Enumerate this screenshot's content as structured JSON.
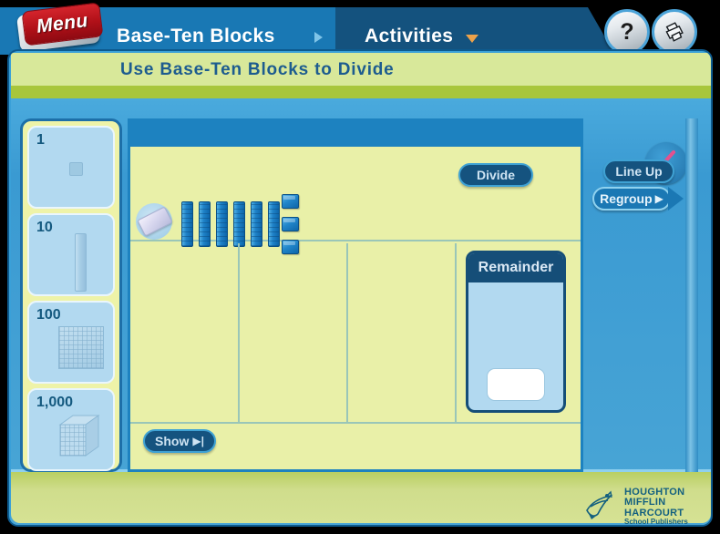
{
  "nav": {
    "menu_label": "Menu",
    "title": "Base-Ten Blocks",
    "arrow_icon": "triangle-right-icon",
    "section": "Activities",
    "caret_icon": "chevron-down-icon",
    "help_label": "?",
    "help_icon": "question-mark-icon",
    "print_icon": "printer-icon"
  },
  "header": {
    "subtitle": "Use Base-Ten Blocks to Divide"
  },
  "tools": {
    "broom_icon": "broom-icon",
    "eraser_icon": "eraser-icon"
  },
  "palette": {
    "items": [
      {
        "label": "1",
        "block": "unit-cube"
      },
      {
        "label": "10",
        "block": "rod"
      },
      {
        "label": "100",
        "block": "flat"
      },
      {
        "label": "1,000",
        "block": "large-cube"
      }
    ]
  },
  "workspace": {
    "rod_count": 6,
    "unit_count": 3,
    "column_count": 3,
    "remainder": {
      "title": "Remainder",
      "value": ""
    }
  },
  "buttons": {
    "divide": "Divide",
    "line_up": "Line Up",
    "regroup": "Regroup",
    "regroup_glyph": "▶",
    "show": "Show",
    "show_glyph": "▶|"
  },
  "footer": {
    "logo_line1": "HOUGHTON",
    "logo_line2": "MIFFLIN",
    "logo_line3": "HARCOURT",
    "logo_tagline": "School Publishers"
  },
  "colors": {
    "nav_blue": "#1978b4",
    "nav_dark": "#14527e",
    "panel_blue": "#3aa0d8",
    "work_bg": "#e9f0a8",
    "subbar": "#d8e89a",
    "olive": "#a8c63c",
    "block_blue": "#1f82c8",
    "menu_red": "#b01018",
    "caret_orange": "#eda24a"
  }
}
